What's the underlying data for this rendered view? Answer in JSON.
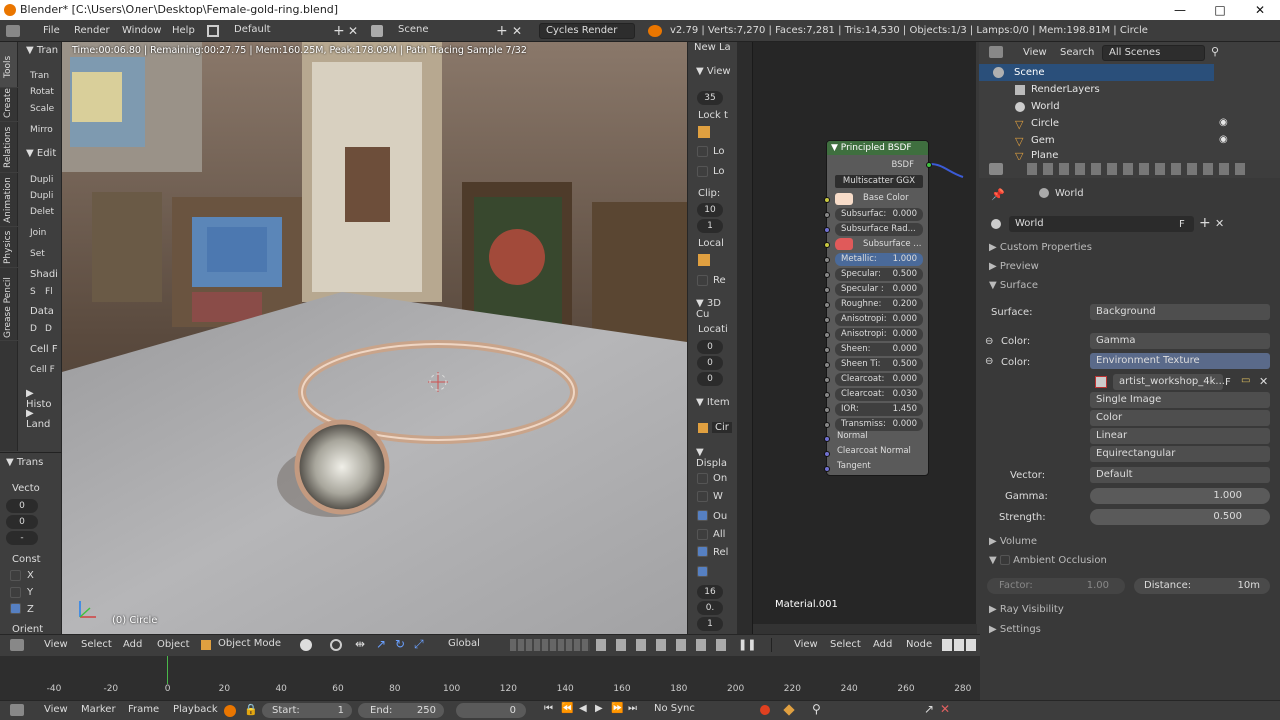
{
  "window": {
    "title": "Blender* [C:\\Users\\Олег\\Desktop\\Female-gold-ring.blend]",
    "minimize": "—",
    "maximize": "□",
    "close": "✕"
  },
  "info_header": {
    "menus": [
      "File",
      "Render",
      "Window",
      "Help"
    ],
    "layout": "Default",
    "scene": "Scene",
    "engine": "Cycles Render",
    "stats": "v2.79 | Verts:7,270 | Faces:7,281 | Tris:14,530 | Objects:1/3 | Lamps:0/0 | Mem:198.81M | Circle"
  },
  "viewport": {
    "render_status": "Time:00:06.80 | Remaining:00:27.75 | Mem:160.25M, Peak:178.09M | Path Tracing Sample 7/32",
    "object_label": "(0) Circle"
  },
  "tool_shelf": {
    "tabs": [
      "Tools",
      "Create",
      "Relations",
      "Animation",
      "Physics",
      "Grease Pencil"
    ],
    "transform_header": "Tran",
    "transform_buttons": [
      "Tran",
      "Rotat",
      "Scale",
      "Mirro"
    ],
    "edit_header": "Edit",
    "edit_buttons": [
      "Dupli",
      "Dupli",
      "Delet",
      "Join",
      "Set"
    ],
    "shading_label": "Shadi",
    "shading_buttons": [
      "S",
      "Fl"
    ],
    "data_label": "Data",
    "data_buttons": [
      "D",
      "D"
    ],
    "cellf_label": "Cell F",
    "cellf_button": "Cell F",
    "history": "Histo",
    "land": "Land",
    "trans_panel": "Trans",
    "vector_label": "Vecto",
    "vector_vals": [
      "0",
      "0",
      "-"
    ],
    "constraint_label": "Const",
    "axes": [
      "X",
      "Y",
      "Z"
    ],
    "orient_label": "Orient"
  },
  "n_panel": {
    "new_layer": "New La",
    "view_header": "View",
    "lens": "35",
    "lock_label": "Lock t",
    "lock_opts": [
      "Lo",
      "Lo"
    ],
    "clip_label": "Clip:",
    "clip_vals": [
      "10",
      "1"
    ],
    "local_label": "Local",
    "re_label": "Re",
    "cursor_header": "3D Cu",
    "location_label": "Locati",
    "loc_vals": [
      "0",
      "0",
      "0"
    ],
    "item_header": "Item",
    "item_name": "Cir",
    "display_header": "Displa",
    "display_opts": [
      "On",
      "W",
      "Ou",
      "All",
      "Rel"
    ],
    "display_vals": [
      "16",
      "0.",
      "1"
    ]
  },
  "node": {
    "title": "Principled BSDF",
    "output": "BSDF",
    "distribution": "Multiscatter GGX",
    "base_color_label": "Base Color",
    "base_color": "#f7dcc9",
    "ss_color": "#e05a5a",
    "rows": [
      {
        "label": "Subsurfac:",
        "value": "0.000"
      },
      {
        "label": "Subsurface Rad...",
        "value": ""
      },
      {
        "label": "Subsurface ...",
        "value": ""
      },
      {
        "label": "Metallic:",
        "value": "1.000"
      },
      {
        "label": "Specular:",
        "value": "0.500"
      },
      {
        "label": "Specular :",
        "value": "0.000"
      },
      {
        "label": "Roughne:",
        "value": "0.200"
      },
      {
        "label": "Anisotropi:",
        "value": "0.000"
      },
      {
        "label": "Anisotropi:",
        "value": "0.000"
      },
      {
        "label": "Sheen:",
        "value": "0.000"
      },
      {
        "label": "Sheen Ti:",
        "value": "0.500"
      },
      {
        "label": "Clearcoat:",
        "value": "0.000"
      },
      {
        "label": "Clearcoat:",
        "value": "0.030"
      },
      {
        "label": "IOR:",
        "value": "1.450"
      },
      {
        "label": "Transmiss:",
        "value": "0.000"
      }
    ],
    "inputs": [
      "Normal",
      "Clearcoat Normal",
      "Tangent"
    ],
    "material": "Material.001"
  },
  "outliner": {
    "menus": [
      "View",
      "Search"
    ],
    "filter": "All Scenes",
    "items": [
      {
        "label": "Scene",
        "level": 0
      },
      {
        "label": "RenderLayers",
        "level": 1
      },
      {
        "label": "World",
        "level": 1
      },
      {
        "label": "Circle",
        "level": 1
      },
      {
        "label": "Gem",
        "level": 1
      },
      {
        "label": "Plane",
        "level": 1
      }
    ]
  },
  "properties": {
    "breadcrumb": "World",
    "world_name": "World",
    "fake_user": "F",
    "sections": [
      "Custom Properties",
      "Preview",
      "Surface",
      "Volume",
      "Ambient Occlusion",
      "Ray Visibility",
      "Settings"
    ],
    "surface_label": "Surface:",
    "surface_value": "Background",
    "color1_label": "Color:",
    "color1_value": "Gamma",
    "color2_label": "Color:",
    "color2_value": "Environment Texture",
    "image": "artist_workshop_4k....",
    "image_opts": [
      "Single Image",
      "Color",
      "Linear",
      "Equirectangular"
    ],
    "vector_label": "Vector:",
    "vector_value": "Default",
    "gamma_label": "Gamma:",
    "gamma_value": "1.000",
    "strength_label": "Strength:",
    "strength_value": "0.500",
    "factor_label": "Factor:",
    "factor_value": "1.00",
    "distance_label": "Distance:",
    "distance_value": "10m"
  },
  "viewport_header": {
    "menus": [
      "View",
      "Select",
      "Add",
      "Object"
    ],
    "mode": "Object Mode",
    "orientation": "Global"
  },
  "node_header": {
    "menus": [
      "View",
      "Select",
      "Add",
      "Node"
    ]
  },
  "timeline": {
    "ticks": [
      "-40",
      "-20",
      "0",
      "20",
      "40",
      "60",
      "80",
      "100",
      "120",
      "140",
      "160",
      "180",
      "200",
      "220",
      "240",
      "260",
      "280"
    ],
    "menus": [
      "View",
      "Marker",
      "Frame",
      "Playback"
    ],
    "start_label": "Start:",
    "start": "1",
    "end_label": "End:",
    "end": "250",
    "current": "0",
    "sync": "No Sync"
  }
}
